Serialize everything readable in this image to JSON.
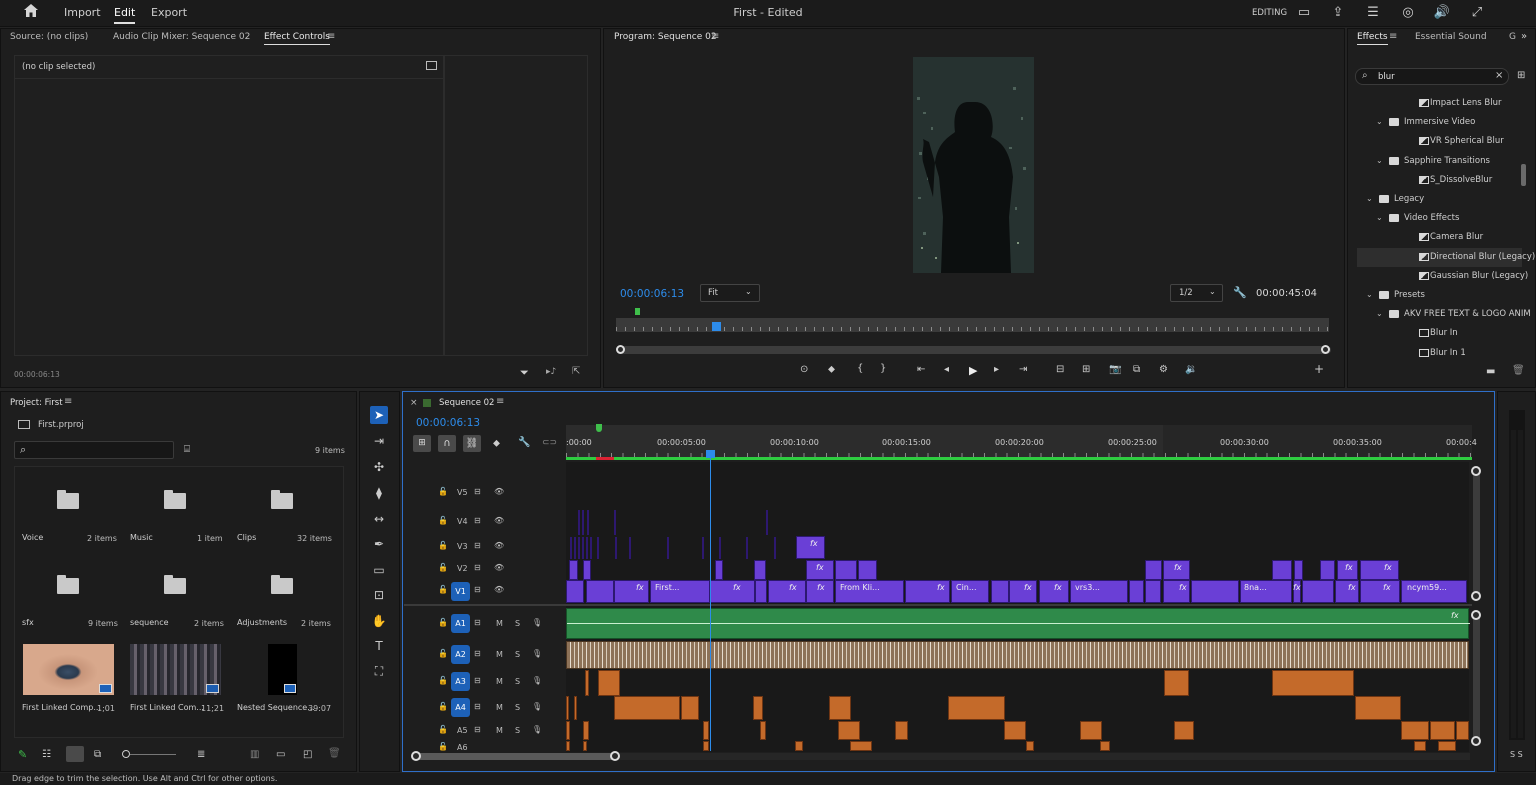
{
  "app": {
    "title": "First - Edited",
    "menus": [
      "Import",
      "Edit",
      "Export"
    ],
    "workspace": "EDITING"
  },
  "source_panel": {
    "tabs": [
      "Source: (no clips)",
      "Audio Clip Mixer: Sequence 02",
      "Effect Controls"
    ],
    "active_tab": "Effect Controls",
    "no_clip": "(no clip selected)",
    "timecode": "00:00:06:13"
  },
  "program": {
    "title": "Program: Sequence 02",
    "timecode": "00:00:06:13",
    "fit": "Fit",
    "resolution": "1/2",
    "duration": "00:00:45:04"
  },
  "effects_panel": {
    "tabs": [
      "Effects",
      "Essential Sound",
      "G"
    ],
    "search_value": "blur",
    "tree": [
      {
        "label": "Impact Lens Blur",
        "type": "fx",
        "level": 3,
        "chev": ""
      },
      {
        "label": "Immersive Video",
        "type": "folder",
        "level": 2,
        "chev": "v"
      },
      {
        "label": "VR Spherical Blur",
        "type": "fx",
        "level": 3,
        "chev": ""
      },
      {
        "label": "Sapphire Transitions",
        "type": "folder",
        "level": 2,
        "chev": "v"
      },
      {
        "label": "S_DissolveBlur",
        "type": "fx",
        "level": 3,
        "chev": ""
      },
      {
        "label": "Legacy",
        "type": "folder",
        "level": 1,
        "chev": "v"
      },
      {
        "label": "Video Effects",
        "type": "folder",
        "level": 2,
        "chev": "v"
      },
      {
        "label": "Camera Blur",
        "type": "fx",
        "level": 3,
        "chev": ""
      },
      {
        "label": "Directional Blur (Legacy)",
        "type": "fx",
        "level": 3,
        "chev": ""
      },
      {
        "label": "Gaussian Blur (Legacy)",
        "type": "fx",
        "level": 3,
        "chev": ""
      },
      {
        "label": "Presets",
        "type": "folder",
        "level": 1,
        "chev": "v"
      },
      {
        "label": "AKV FREE TEXT & LOGO ANIM",
        "type": "folder",
        "level": 2,
        "chev": "v"
      },
      {
        "label": "Blur In",
        "type": "preset",
        "level": 3,
        "chev": ""
      },
      {
        "label": "Blur In 1",
        "type": "preset",
        "level": 3,
        "chev": ""
      }
    ]
  },
  "project": {
    "title": "Project: First",
    "file": "First.prproj",
    "item_count": "9 items",
    "bins": [
      {
        "name": "Voice",
        "count": "2 items"
      },
      {
        "name": "Music",
        "count": "1 item"
      },
      {
        "name": "Clips",
        "count": "32 items"
      },
      {
        "name": "sfx",
        "count": "9 items"
      },
      {
        "name": "sequence",
        "count": "2 items"
      },
      {
        "name": "Adjustments",
        "count": "2 items"
      }
    ],
    "media": [
      {
        "name": "First Linked Comp...",
        "duration": "1;01"
      },
      {
        "name": "First Linked Com...",
        "duration": "11;21"
      },
      {
        "name": "Nested Sequence...",
        "duration": "39:07"
      }
    ]
  },
  "timeline": {
    "title": "Sequence 02",
    "timecode": "00:00:06:13",
    "ruler": [
      ":00:00",
      "00:00:05:00",
      "00:00:10:00",
      "00:00:15:00",
      "00:00:20:00",
      "00:00:25:00",
      "00:00:30:00",
      "00:00:35:00",
      "00:00:4"
    ],
    "video_tracks": [
      "V5",
      "V4",
      "V3",
      "V2",
      "V1"
    ],
    "audio_tracks": [
      "A1",
      "A2",
      "A3",
      "A4",
      "A5",
      "A6"
    ],
    "clip_labels": [
      "First...",
      "From Kli...",
      "Cin...",
      "vrs3...",
      "8na...",
      "ncym59..."
    ],
    "fx": "fx",
    "track_m": "M",
    "track_s": "S"
  },
  "status_bar": "Drag edge to trim the selection. Use Alt and Ctrl for other options.",
  "meter_labels": "S S",
  "colors": {
    "accent": "#2d8ceb",
    "video_clip": "#6a3fd6",
    "audio_clip": "#c46a2a",
    "a1_clip": "#3a9a54"
  }
}
